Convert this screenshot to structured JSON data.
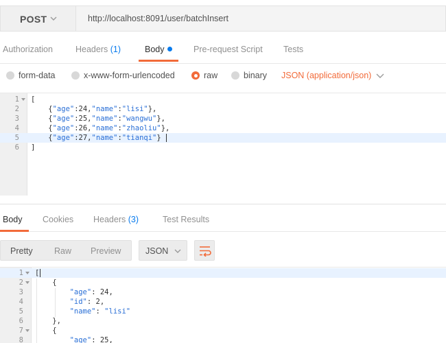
{
  "request": {
    "method": "POST",
    "url": "http://localhost:8091/user/batchInsert",
    "tabs": [
      {
        "label": "Authorization"
      },
      {
        "label": "Headers",
        "count": "(1)"
      },
      {
        "label": "Body"
      },
      {
        "label": "Pre-request Script"
      },
      {
        "label": "Tests"
      }
    ],
    "active_tab": "Body",
    "body_types": [
      {
        "label": "form-data",
        "selected": false
      },
      {
        "label": "x-www-form-urlencoded",
        "selected": false
      },
      {
        "label": "raw",
        "selected": true
      },
      {
        "label": "binary",
        "selected": false
      }
    ],
    "content_type": "JSON (application/json)",
    "body_lines": [
      {
        "n": "1",
        "text": "["
      },
      {
        "n": "2",
        "text": "    {\"age\":24,\"name\":\"lisi\"},"
      },
      {
        "n": "3",
        "text": "    {\"age\":25,\"name\":\"wangwu\"},"
      },
      {
        "n": "4",
        "text": "    {\"age\":26,\"name\":\"zhaoliu\"},"
      },
      {
        "n": "5",
        "text": "    {\"age\":27,\"name\":\"tianqi\"}"
      },
      {
        "n": "6",
        "text": "]"
      }
    ]
  },
  "response": {
    "tabs": [
      {
        "label": "Body"
      },
      {
        "label": "Cookies"
      },
      {
        "label": "Headers",
        "count": "(3)"
      },
      {
        "label": "Test Results"
      }
    ],
    "active_tab": "Body",
    "views": [
      "Pretty",
      "Raw",
      "Preview"
    ],
    "active_view": "Pretty",
    "format": "JSON",
    "wrap_icon": "wrap-lines-icon",
    "body_lines": [
      {
        "n": "1",
        "text": "["
      },
      {
        "n": "2",
        "text": "    {"
      },
      {
        "n": "3",
        "text": "        \"age\": 24,"
      },
      {
        "n": "4",
        "text": "        \"id\": 2,"
      },
      {
        "n": "5",
        "text": "        \"name\": \"lisi\""
      },
      {
        "n": "6",
        "text": "    },"
      },
      {
        "n": "7",
        "text": "    {"
      },
      {
        "n": "8",
        "text": "        \"age\": 25,"
      }
    ]
  },
  "colors": {
    "accent": "#f26b3a",
    "link_blue": "#097bed",
    "string_blue": "#2a6fd6"
  }
}
